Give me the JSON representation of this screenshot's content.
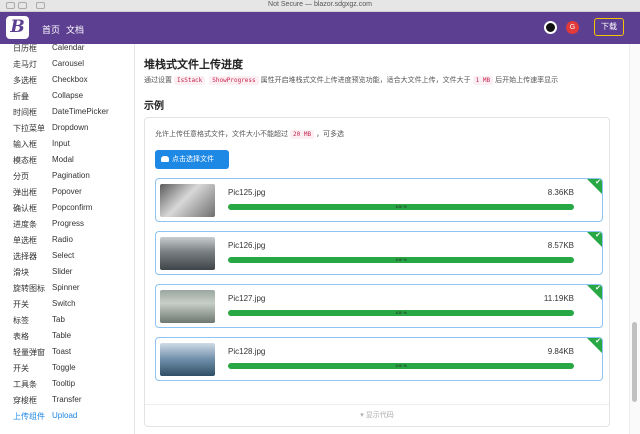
{
  "browser": {
    "url": "Not Secure — blazor.sdgxgz.com"
  },
  "topnav": {
    "logo": "B",
    "home": "首页",
    "docs": "文档",
    "download": "下载"
  },
  "sidebar": {
    "items": [
      {
        "zh": "日历框",
        "en": "Calendar"
      },
      {
        "zh": "走马灯",
        "en": "Carousel"
      },
      {
        "zh": "多选框",
        "en": "Checkbox"
      },
      {
        "zh": "折叠",
        "en": "Collapse"
      },
      {
        "zh": "时间框",
        "en": "DateTimePicker"
      },
      {
        "zh": "下拉菜单",
        "en": "Dropdown"
      },
      {
        "zh": "输入框",
        "en": "Input"
      },
      {
        "zh": "模态框",
        "en": "Modal"
      },
      {
        "zh": "分页",
        "en": "Pagination"
      },
      {
        "zh": "弹出框",
        "en": "Popover"
      },
      {
        "zh": "确认框",
        "en": "Popconfirm"
      },
      {
        "zh": "进度条",
        "en": "Progress"
      },
      {
        "zh": "单选框",
        "en": "Radio"
      },
      {
        "zh": "选择器",
        "en": "Select"
      },
      {
        "zh": "滑块",
        "en": "Slider"
      },
      {
        "zh": "旋转图标",
        "en": "Spinner"
      },
      {
        "zh": "开关",
        "en": "Switch"
      },
      {
        "zh": "标签",
        "en": "Tab"
      },
      {
        "zh": "表格",
        "en": "Table"
      },
      {
        "zh": "轻量弹窗",
        "en": "Toast"
      },
      {
        "zh": "开关",
        "en": "Toggle"
      },
      {
        "zh": "工具条",
        "en": "Tooltip"
      },
      {
        "zh": "穿梭框",
        "en": "Transfer"
      },
      {
        "zh": "上传组件",
        "en": "Upload"
      }
    ]
  },
  "main": {
    "title": "堆栈式文件上传进度",
    "desc_1": "通过设置",
    "code_1": "IsStack",
    "code_2": "ShowProgress",
    "desc_2": "属性开启堆栈式文件上传进度预览功能，适合大文件上传，文件大于",
    "code_3": "1 MB",
    "desc_3": "后开始上传速率显示",
    "example": "示例",
    "card_desc_1": "允许上传任意格式文件，文件大小不能超过",
    "card_code": "20 MB",
    "card_desc_2": "，可多选",
    "upload_button": "点击选择文件",
    "show_code": "显示代码",
    "files": [
      {
        "name": "Pic125.jpg",
        "size": "8.36KB",
        "progress": "100 %",
        "percent": 100
      },
      {
        "name": "Pic126.jpg",
        "size": "8.57KB",
        "progress": "100 %",
        "percent": 100
      },
      {
        "name": "Pic127.jpg",
        "size": "11.19KB",
        "progress": "100 %",
        "percent": 100
      },
      {
        "name": "Pic128.jpg",
        "size": "9.84KB",
        "progress": "100 %",
        "percent": 100
      }
    ]
  },
  "colors": {
    "nav": "#5d3f92",
    "accent": "#1e88e5",
    "success": "#28a745"
  }
}
